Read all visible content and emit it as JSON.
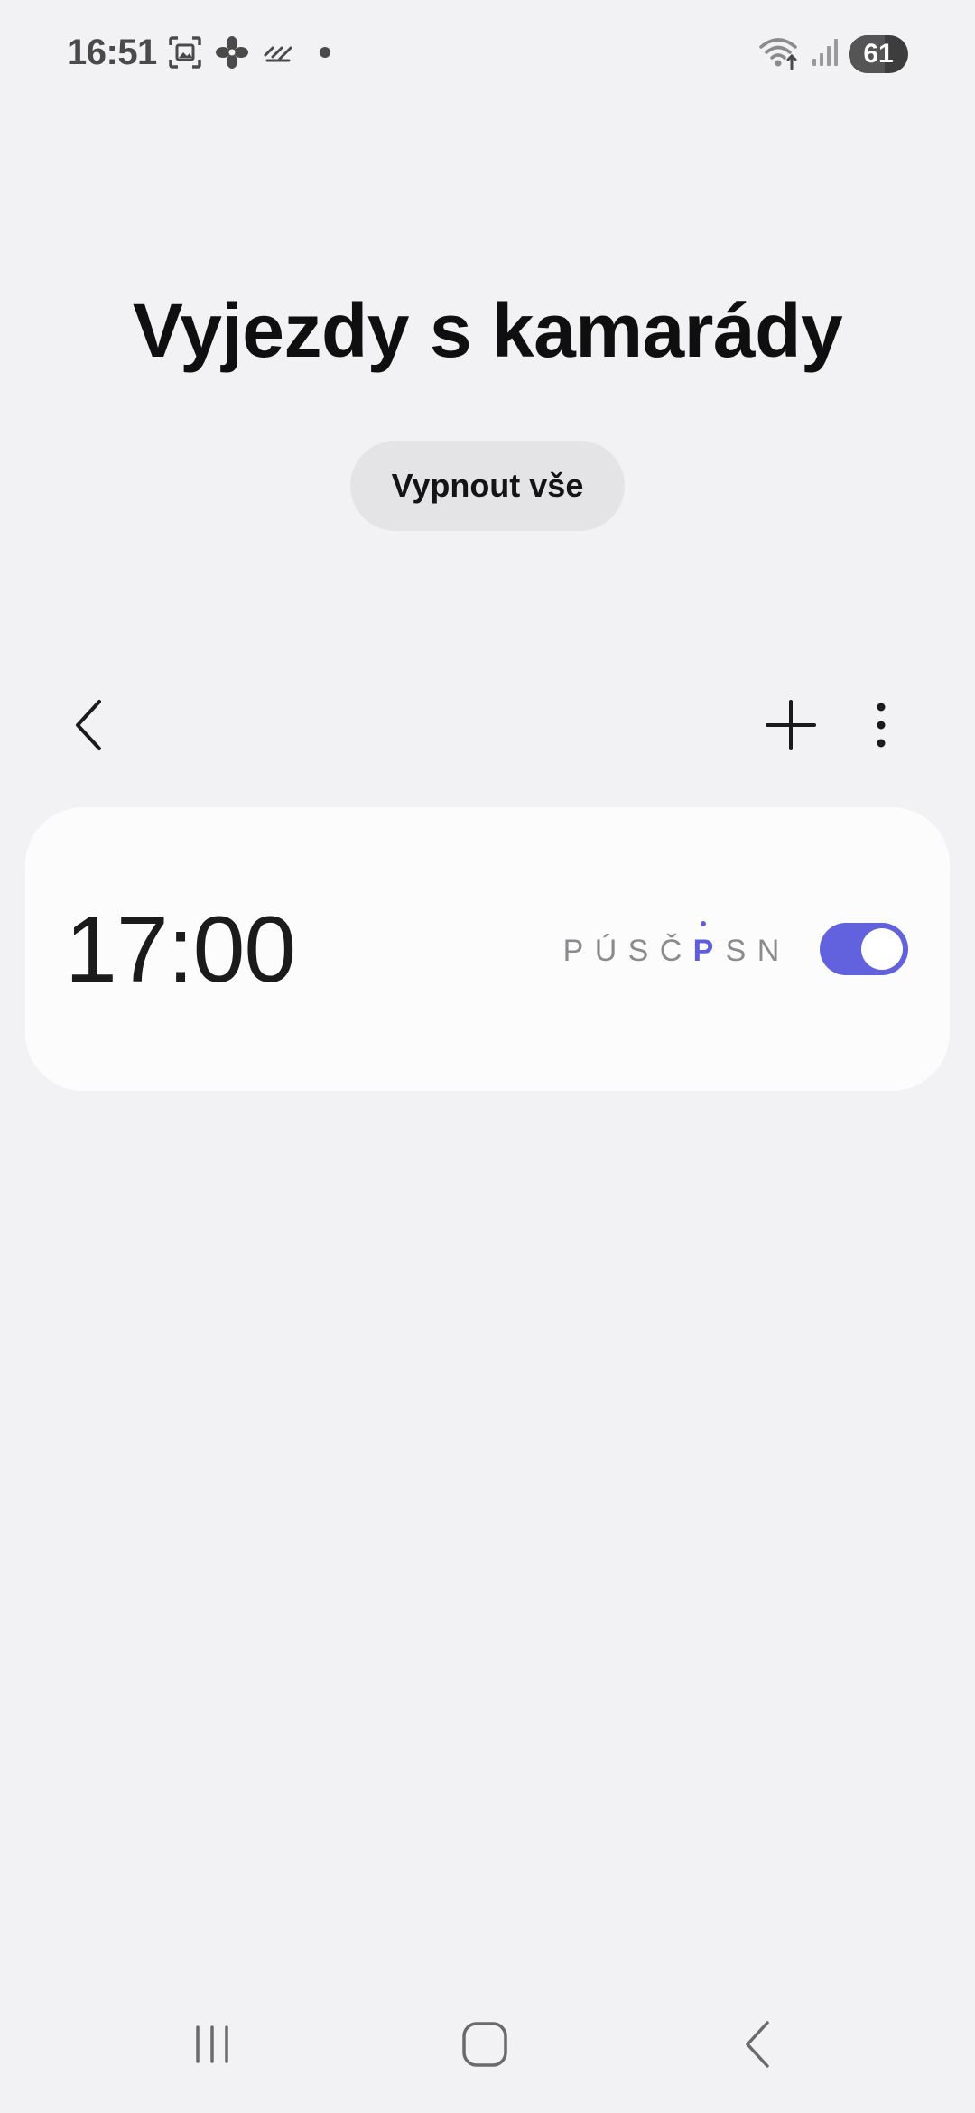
{
  "status_bar": {
    "time": "16:51",
    "battery_level": "61",
    "battery_fraction": 0.61,
    "left_icons": [
      "screenshot-icon",
      "fan-icon",
      "stripes-icon",
      "notification-dot-icon"
    ],
    "right_icons": [
      "wifi-icon",
      "signal-icon",
      "battery-icon"
    ]
  },
  "header": {
    "title": "Vyjezdy s kamarády",
    "disable_all_label": "Vypnout vše"
  },
  "toolbar": {
    "back_icon": "chevron-left-icon",
    "add_icon": "plus-icon",
    "more_icon": "more-vertical-icon"
  },
  "alarm": {
    "time": "17:00",
    "enabled": true,
    "days": [
      {
        "label": "P",
        "active": false
      },
      {
        "label": "Ú",
        "active": false
      },
      {
        "label": "S",
        "active": false
      },
      {
        "label": "Č",
        "active": false
      },
      {
        "label": "P",
        "active": true
      },
      {
        "label": "S",
        "active": false
      },
      {
        "label": "N",
        "active": false
      }
    ]
  },
  "colors": {
    "background": "#f2f2f4",
    "card": "#fcfcfd",
    "accent": "#6262de",
    "inactive_day": "#8b8b8e",
    "pill_button": "#e4e4e6"
  },
  "nav_bar": {
    "recents_icon": "recents-icon",
    "home_icon": "home-icon",
    "back_icon": "back-icon"
  }
}
